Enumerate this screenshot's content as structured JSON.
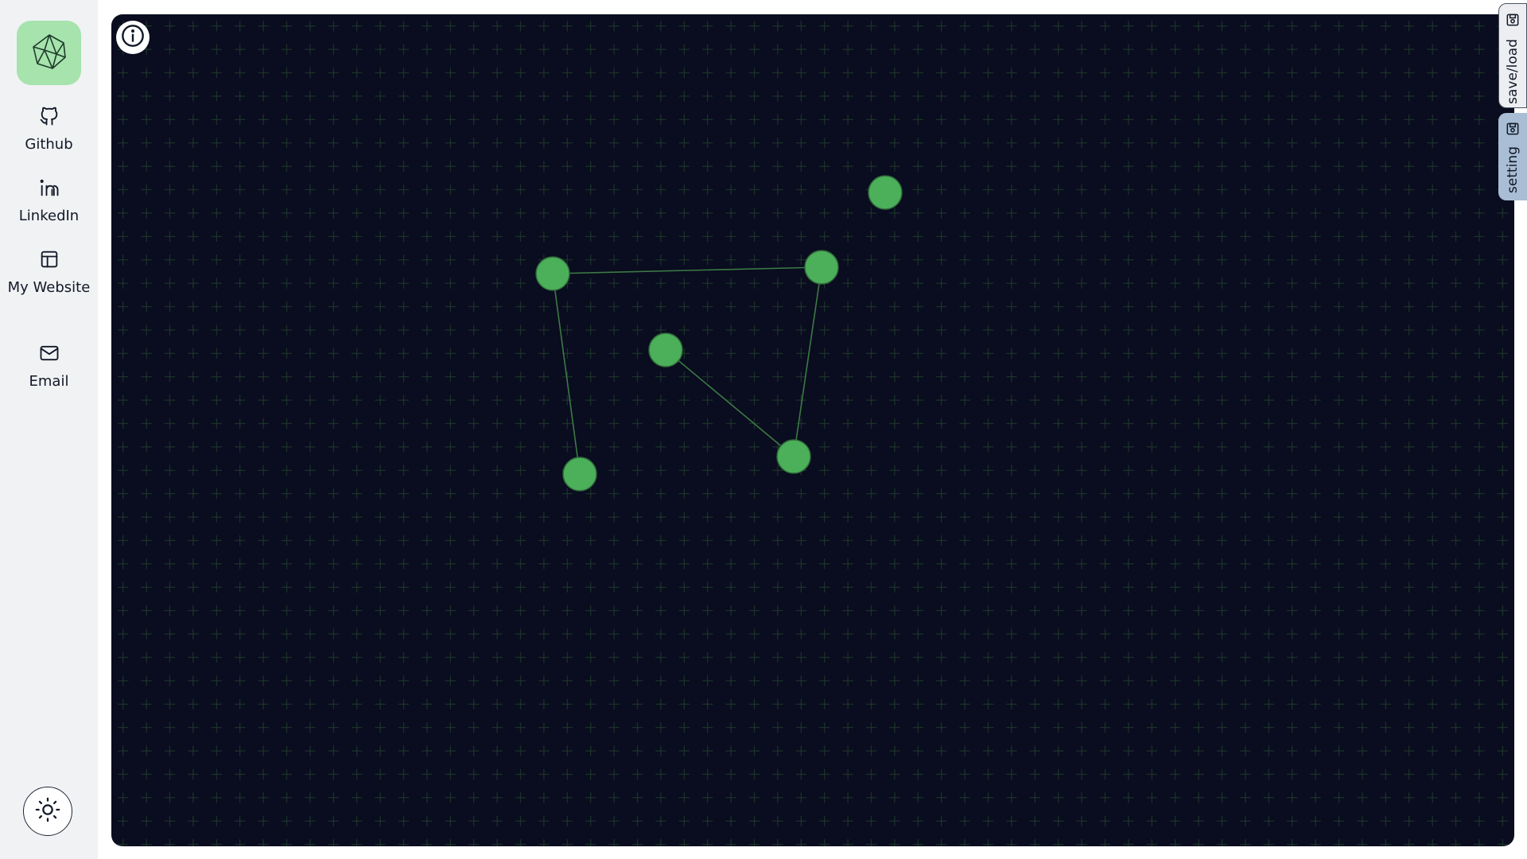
{
  "sidebar": {
    "logo_icon": "polyhedron-graph-icon",
    "items": [
      {
        "label": "Github",
        "icon": "github-icon"
      },
      {
        "label": "LinkedIn",
        "icon": "linkedin-icon"
      },
      {
        "label": "My Website",
        "icon": "layout-icon"
      },
      {
        "label": "Email",
        "icon": "mail-icon"
      }
    ],
    "theme_toggle_icon": "sun-icon"
  },
  "canvas": {
    "background_color": "#0a0c1f",
    "grid_color": "#1e3b2a",
    "node_color": "#4caf5a",
    "edge_color": "#3b7a45",
    "info_icon": "info-icon"
  },
  "panel_tabs": [
    {
      "label": "save/load",
      "icon": "save-icon"
    },
    {
      "label": "setting",
      "icon": "save-icon"
    }
  ],
  "graph": {
    "nodes": [
      {
        "id": 1
      },
      {
        "id": 2
      },
      {
        "id": 3
      },
      {
        "id": 4
      },
      {
        "id": 5
      },
      {
        "id": 6
      }
    ],
    "edges": [
      {
        "from": 2,
        "to": 3
      },
      {
        "from": 2,
        "to": 5
      },
      {
        "from": 3,
        "to": 6
      },
      {
        "from": 4,
        "to": 6
      }
    ]
  }
}
